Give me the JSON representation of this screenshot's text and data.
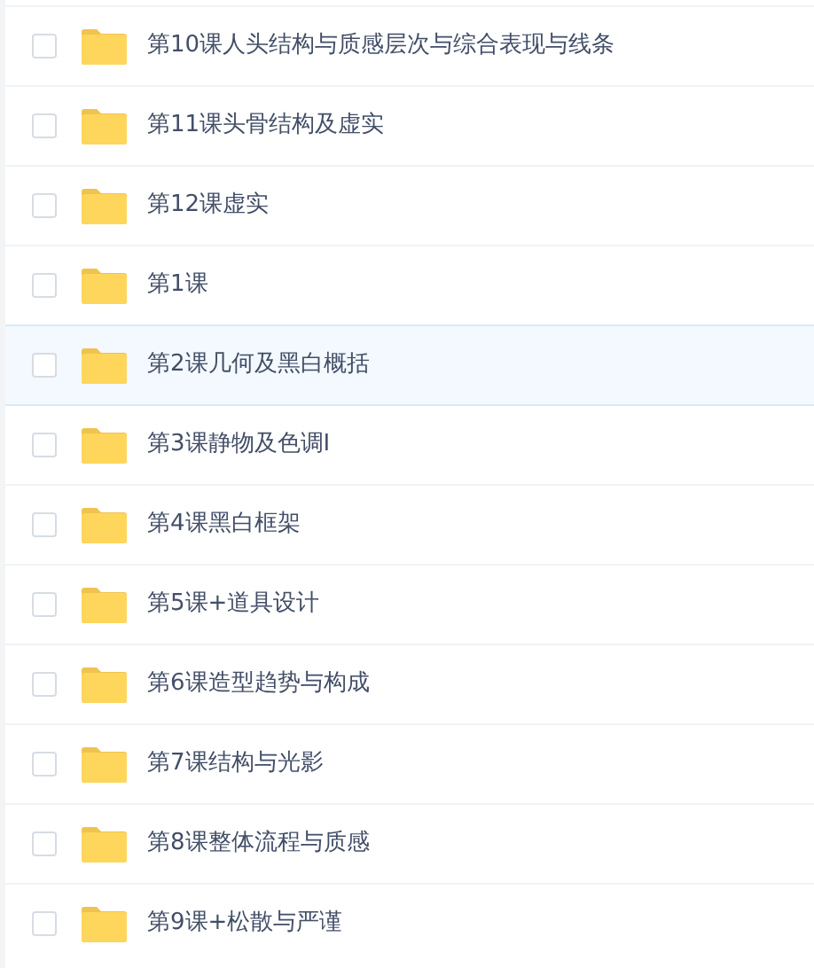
{
  "files": [
    {
      "name": "第10课人头结构与质感层次与综合表现与线条",
      "checked": false,
      "highlighted": false
    },
    {
      "name": "第11课头骨结构及虚实",
      "checked": false,
      "highlighted": false
    },
    {
      "name": "第12课虚实",
      "checked": false,
      "highlighted": false
    },
    {
      "name": "第1课",
      "checked": false,
      "highlighted": false
    },
    {
      "name": "第2课几何及黑白概括",
      "checked": false,
      "highlighted": true
    },
    {
      "name": "第3课静物及色调I",
      "checked": false,
      "highlighted": false
    },
    {
      "name": "第4课黑白框架",
      "checked": false,
      "highlighted": false
    },
    {
      "name": "第5课+道具设计",
      "checked": false,
      "highlighted": false
    },
    {
      "name": "第6课造型趋势与构成",
      "checked": false,
      "highlighted": false
    },
    {
      "name": "第7课结构与光影",
      "checked": false,
      "highlighted": false
    },
    {
      "name": "第8课整体流程与质感",
      "checked": false,
      "highlighted": false
    },
    {
      "name": "第9课+松散与严谨",
      "checked": false,
      "highlighted": false
    }
  ]
}
